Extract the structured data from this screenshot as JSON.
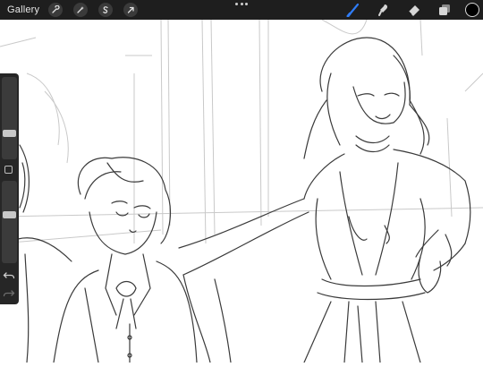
{
  "topbar": {
    "gallery_label": "Gallery",
    "left_tools": [
      {
        "name": "wrench-icon"
      },
      {
        "name": "magic-wand-icon"
      },
      {
        "name": "selection-s-icon"
      },
      {
        "name": "transform-arrow-icon"
      }
    ],
    "right_tools": [
      {
        "name": "brush-icon",
        "active": true
      },
      {
        "name": "smudge-icon"
      },
      {
        "name": "eraser-icon"
      },
      {
        "name": "layers-icon"
      }
    ],
    "current_color": "#000000",
    "accent_color": "#2f7cf6"
  },
  "sidebar": {
    "brush_size_level": 0.3,
    "opacity_level": 0.6,
    "icons": [
      "modifier-square-icon",
      "undo-icon",
      "redo-icon"
    ]
  }
}
